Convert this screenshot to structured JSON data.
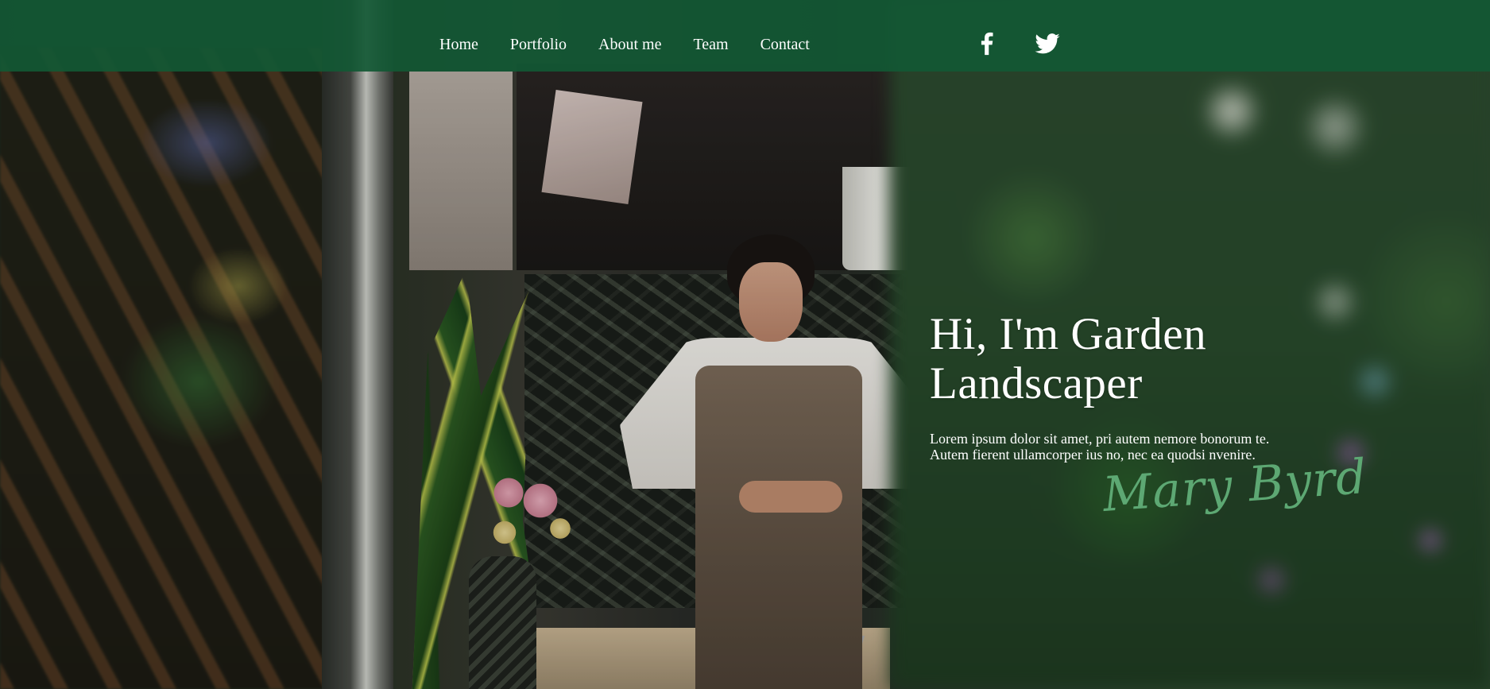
{
  "nav": {
    "items": [
      {
        "label": "Home"
      },
      {
        "label": "Portfolio"
      },
      {
        "label": "About me"
      },
      {
        "label": "Team"
      },
      {
        "label": "Contact"
      }
    ],
    "social": [
      {
        "icon": "facebook-icon"
      },
      {
        "icon": "twitter-icon"
      }
    ]
  },
  "hero": {
    "title_line1": "Hi, I'm Garden",
    "title_line2": "Landscaper",
    "paragraph_line1": "Lorem ipsum dolor sit amet, pri autem nemore bonorum te.",
    "paragraph_line2": "Autem fierent ullamcorper ius no, nec ea quodsi nvenire.",
    "signature": "Mary Byrd"
  },
  "colors": {
    "navbar": "#125834",
    "text": "#ffffff",
    "signature": "#5da873"
  }
}
